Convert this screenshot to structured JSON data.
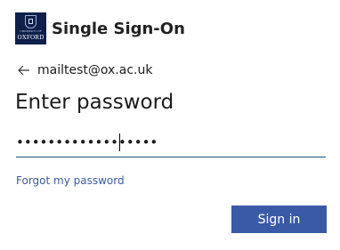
{
  "brand": {
    "logo_line1": "UNIVERSITY OF",
    "logo_line2": "OXFORD",
    "title": "Single Sign-On"
  },
  "identity": {
    "back_icon": "arrow-left-icon",
    "email": "mailtest@ox.ac.uk"
  },
  "heading": "Enter password",
  "password": {
    "masked_value": "••••••••••••••••••"
  },
  "forgot_password_label": "Forgot my password",
  "sign_in_label": "Sign in",
  "colors": {
    "brand_navy": "#0e1f4a",
    "button_blue": "#3a5aa8",
    "link_blue": "#3b5aa5",
    "input_underline": "#1f4e79"
  }
}
